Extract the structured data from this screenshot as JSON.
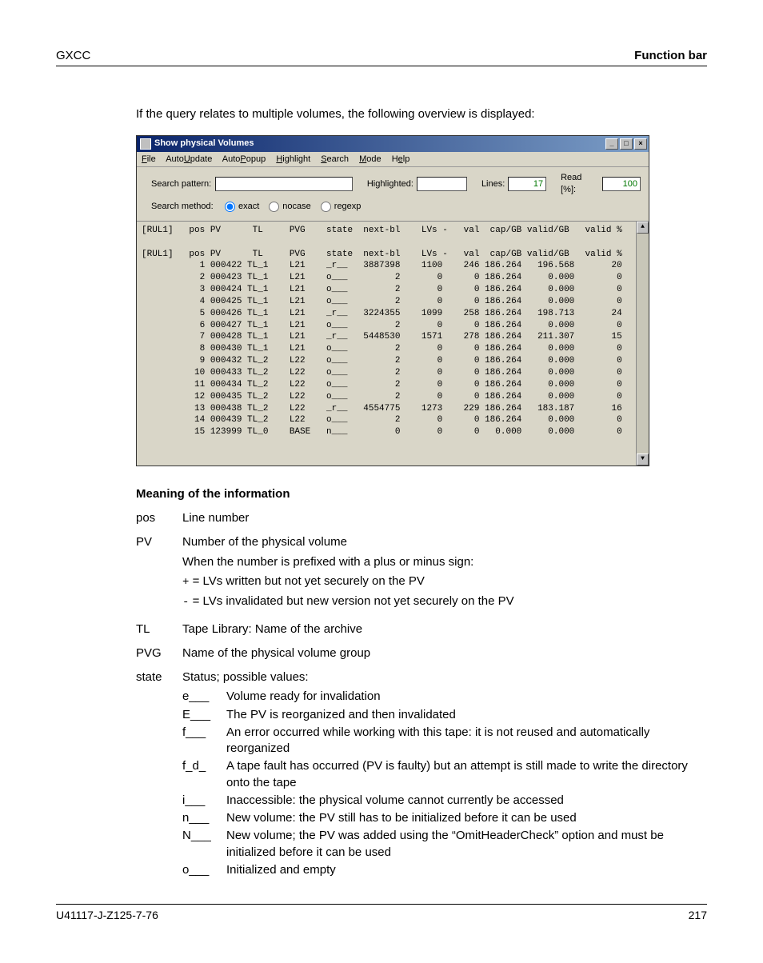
{
  "header": {
    "left": "GXCC",
    "right": "Function bar"
  },
  "intro": "If the query relates to multiple volumes, the following overview is displayed:",
  "win": {
    "title": "Show physical Volumes",
    "menu": {
      "file": "File",
      "auto_update": "AutoUpdate",
      "auto_popup": "AutoPopup",
      "highlight": "Highlight",
      "search": "Search",
      "mode": "Mode",
      "help": "Help"
    },
    "labels": {
      "search_pattern": "Search pattern:",
      "highlighted": "Highlighted:",
      "lines": "Lines:",
      "read": "Read [%]:",
      "search_method": "Search method:",
      "exact": "exact",
      "nocase": "nocase",
      "regexp": "regexp"
    },
    "vals": {
      "lines": "17",
      "read": "100"
    },
    "hdr1": "[RUL1]   pos PV      TL     PVG    state  next-bl    LVs -   val  cap/GB valid/GB   valid %",
    "hdr2": "[RUL1]   pos PV      TL     PVG    state  next-bl    LVs -   val  cap/GB valid/GB   valid %",
    "rows": [
      "           1 000422 TL_1    L21    _r__   3887398    1100    246 186.264   196.568       20",
      "           2 000423 TL_1    L21    o___         2       0      0 186.264     0.000        0",
      "           3 000424 TL_1    L21    o___         2       0      0 186.264     0.000        0",
      "           4 000425 TL_1    L21    o___         2       0      0 186.264     0.000        0",
      "           5 000426 TL_1    L21    _r__   3224355    1099    258 186.264   198.713       24",
      "           6 000427 TL_1    L21    o___         2       0      0 186.264     0.000        0",
      "           7 000428 TL_1    L21    _r__   5448530    1571    278 186.264   211.307       15",
      "           8 000430 TL_1    L21    o___         2       0      0 186.264     0.000        0",
      "           9 000432 TL_2    L22    o___         2       0      0 186.264     0.000        0",
      "          10 000433 TL_2    L22    o___         2       0      0 186.264     0.000        0",
      "          11 000434 TL_2    L22    o___         2       0      0 186.264     0.000        0",
      "          12 000435 TL_2    L22    o___         2       0      0 186.264     0.000        0",
      "          13 000438 TL_2    L22    _r__   4554775    1273    229 186.264   183.187       16",
      "          14 000439 TL_2    L22    o___         2       0      0 186.264     0.000        0",
      "          15 123999 TL_0    BASE   n___         0       0      0   0.000     0.000        0"
    ]
  },
  "section_head": "Meaning of the information",
  "defs": {
    "pos": {
      "term": "pos",
      "body": "Line number"
    },
    "pv": {
      "term": "PV",
      "body": "Number of the physical volume",
      "extra": "When the number is prefixed with a plus or minus sign:",
      "plus_code": "+",
      "plus_txt": " = LVs written but not yet securely on the PV",
      "minus_code": "-",
      "minus_txt": " = LVs invalidated but new version not yet securely on the PV"
    },
    "tl": {
      "term": "TL",
      "body": "Tape Library: Name of the archive"
    },
    "pvg": {
      "term": "PVG",
      "body": "Name of the physical volume group"
    },
    "state": {
      "term": "state",
      "body": "Status; possible values:"
    }
  },
  "states": [
    {
      "code": "e___",
      "desc": "Volume ready for invalidation"
    },
    {
      "code": "E___",
      "desc": "The PV is reorganized and then invalidated"
    },
    {
      "code": "f___",
      "desc": "An error occurred while working with this tape: it is not reused and automatically reorganized"
    },
    {
      "code": "f_d_",
      "desc": "A tape fault has occurred (PV is faulty) but an attempt is still made to write the directory onto the tape"
    },
    {
      "code": "i___",
      "desc": "Inaccessible: the physical volume cannot currently be accessed"
    },
    {
      "code": "n___",
      "desc": "New volume: the PV still has to be initialized before it can be used"
    },
    {
      "code": "N___",
      "desc": "New volume; the PV was added using the “OmitHeaderCheck” option and must be initialized before it can be used"
    },
    {
      "code": "o___",
      "desc": "Initialized and empty"
    }
  ],
  "footer": {
    "left": "U41117-J-Z125-7-76",
    "right": "217"
  }
}
